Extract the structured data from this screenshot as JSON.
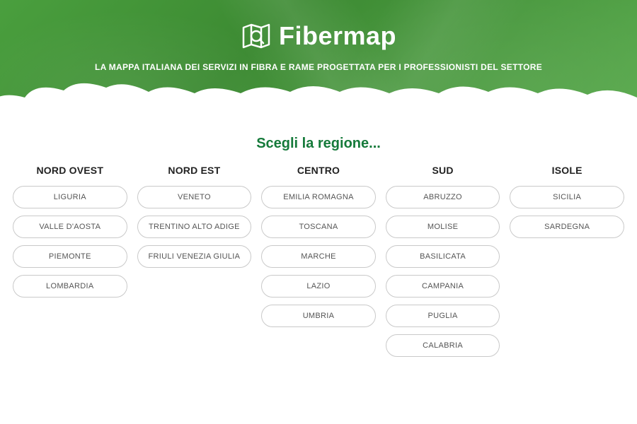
{
  "header": {
    "logo_text": "Fibermap",
    "tagline": "LA MAPPA ITALIANA DEI SERVIZI IN FIBRA E RAME PROGETTATA PER I PROFESSIONISTI DEL SETTORE"
  },
  "main": {
    "choose_title": "Scegli la regione...",
    "columns": [
      {
        "title": "NORD OVEST",
        "regions": [
          "LIGURIA",
          "VALLE D'AOSTA",
          "PIEMONTE",
          "LOMBARDIA"
        ]
      },
      {
        "title": "NORD EST",
        "regions": [
          "VENETO",
          "TRENTINO ALTO ADIGE",
          "FRIULI VENEZIA GIULIA"
        ]
      },
      {
        "title": "CENTRO",
        "regions": [
          "EMILIA ROMAGNA",
          "TOSCANA",
          "MARCHE",
          "LAZIO",
          "UMBRIA"
        ]
      },
      {
        "title": "SUD",
        "regions": [
          "ABRUZZO",
          "MOLISE",
          "BASILICATA",
          "CAMPANIA",
          "PUGLIA",
          "CALABRIA"
        ]
      },
      {
        "title": "ISOLE",
        "regions": [
          "SICILIA",
          "SARDEGNA"
        ]
      }
    ]
  }
}
